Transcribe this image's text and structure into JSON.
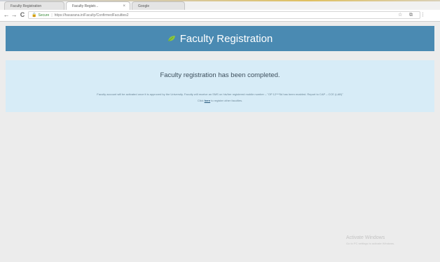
{
  "browser": {
    "tabs": [
      {
        "label": "Faculty Registration"
      },
      {
        "label": "Faculty Registr..."
      },
      {
        "label": "Google"
      }
    ],
    "nav": {
      "back": "←",
      "forward": "→",
      "reload": "C"
    },
    "address": {
      "secure_label": "Secure",
      "url": "https://hasarana.in/Faculty/ConfirmedFaculties2"
    },
    "icons": [
      "star-icon",
      "extension-icon",
      "menu-icon"
    ]
  },
  "header": {
    "title": "Faculty Registration"
  },
  "message": {
    "title": "Faculty registration has been completed.",
    "detail": "Faculty account will be activated once it is approved by the University. Faculty will receive an SMS on his/her registered mobile number – \"OP 12***5d has been enabled. Report to CAP – CCE (LAB)\"",
    "link_prefix": "Click",
    "link_text": "here",
    "link_suffix": "to register other faculties."
  },
  "watermark": {
    "title": "Activate Windows",
    "subtitle": "Go to PC settings to activate Windows."
  },
  "colors": {
    "header_bg": "#4a8ab2",
    "panel_bg": "#d7ecf7",
    "page_bg": "#ececec",
    "leaf": "#8cc63f"
  }
}
